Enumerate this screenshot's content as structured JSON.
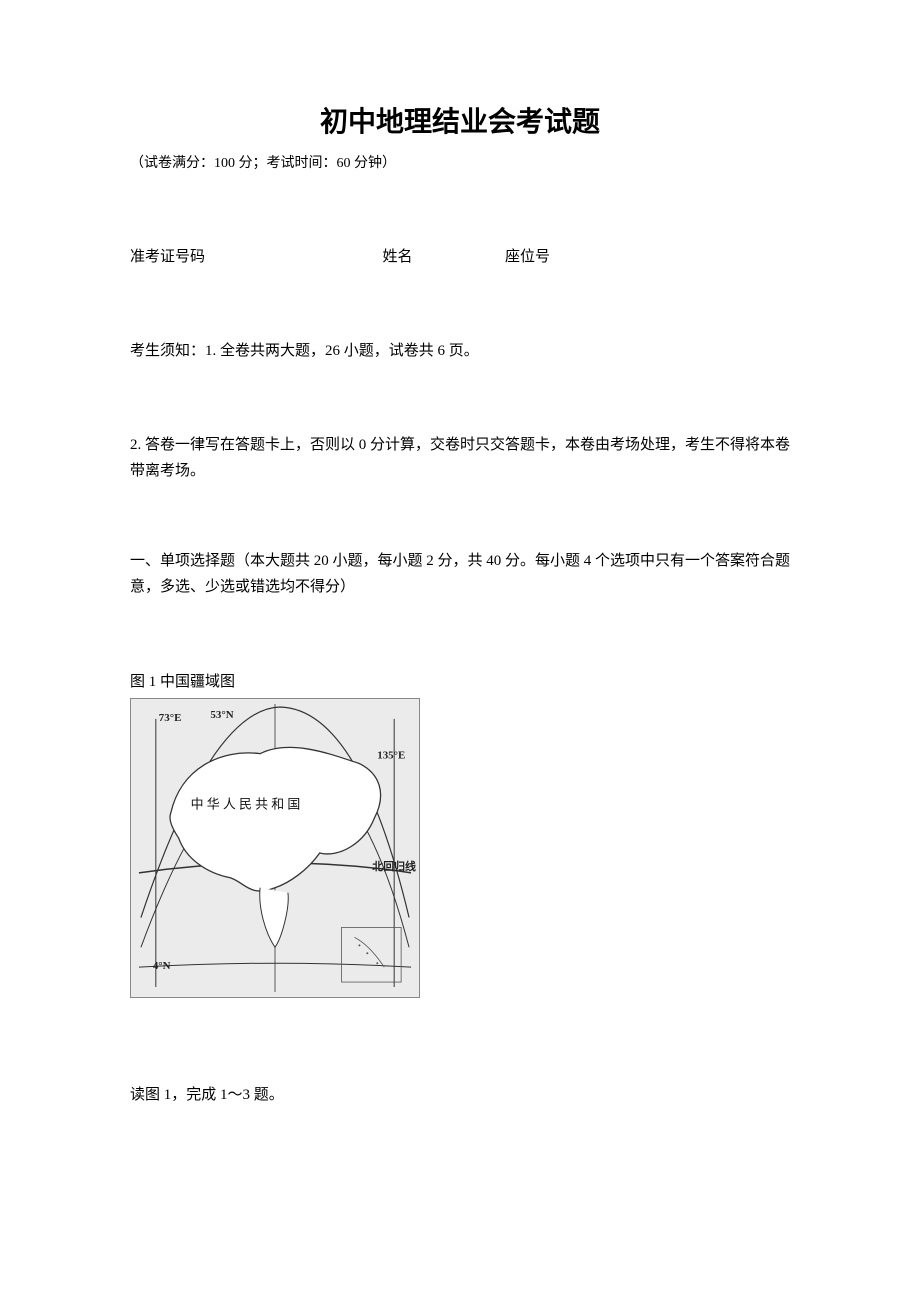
{
  "header": {
    "title": "初中地理结业会考试题",
    "subtitle": "（试卷满分：100 分；考试时间：60 分钟）"
  },
  "info": {
    "exam_id_label": "准考证号码",
    "name_label": "姓名",
    "seat_label": "座位号"
  },
  "instructions": {
    "line1": "考生须知：1. 全卷共两大题，26 小题，试卷共 6 页。",
    "line2": "2. 答卷一律写在答题卡上，否则以 0 分计算，交卷时只交答题卡，本卷由考场处理，考生不得将本卷带离考场。"
  },
  "section1": {
    "heading": "一、单项选择题（本大题共 20 小题，每小题 2 分，共 40 分。每小题 4 个选项中只有一个答案符合题意，多选、少选或错选均不得分）"
  },
  "figure1": {
    "caption": "图 1  中国疆域图",
    "map_labels": {
      "lon_left": "73°E",
      "lat_top": "53°N",
      "lon_right": "135°E",
      "country": "中 华 人 民 共 和 国",
      "tropic": "北回归线",
      "lat_bottom": "4°N"
    }
  },
  "question_ref": "读图 1，完成 1～3 题。"
}
